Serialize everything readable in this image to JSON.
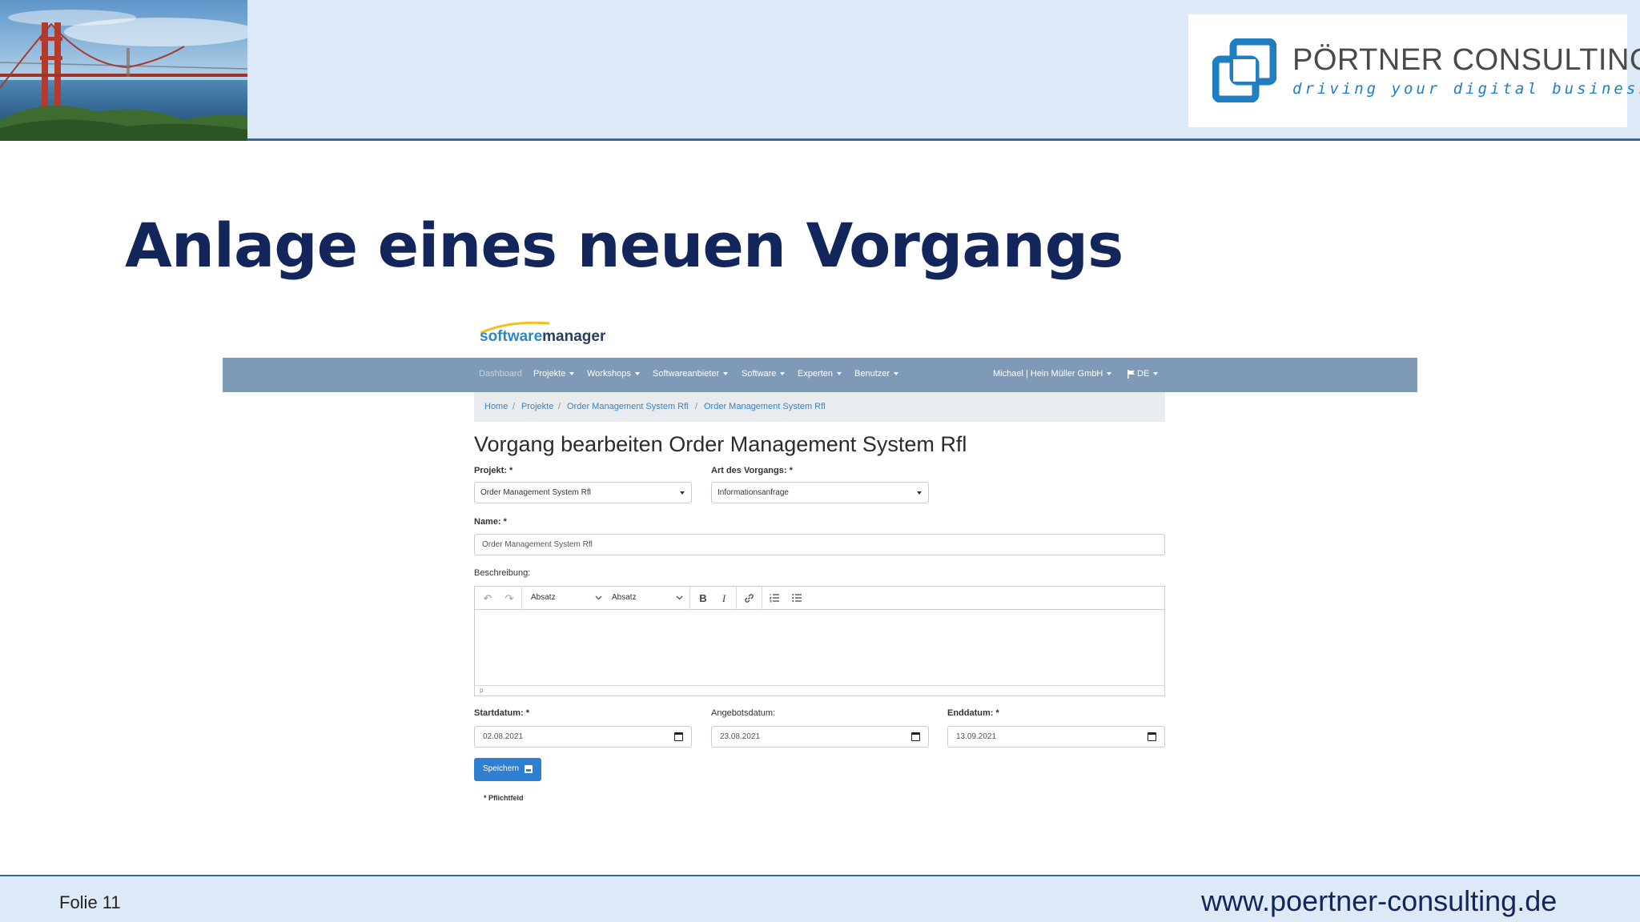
{
  "header": {
    "logo": {
      "name": "PÖRTNER CONSULTING",
      "tagline": "driving your digital business",
      "brand_color": "#1f7fc0"
    }
  },
  "slide": {
    "title": "Anlage eines neuen Vorgangs"
  },
  "app": {
    "brand": {
      "part1": "software",
      "part2": "manager"
    },
    "nav": {
      "items": [
        {
          "label": "Dashboard"
        },
        {
          "label": "Projekte"
        },
        {
          "label": "Workshops"
        },
        {
          "label": "Softwareanbieter"
        },
        {
          "label": "Software"
        },
        {
          "label": "Experten"
        },
        {
          "label": "Benutzer"
        }
      ],
      "user": "Michael | Hein Müller GmbH",
      "language": "DE",
      "bar_color": "#7e9ab6"
    },
    "breadcrumb": [
      "Home",
      "Projekte",
      "Order Management System Rfl",
      "Order Management System Rfl"
    ],
    "form": {
      "heading": "Vorgang bearbeiten Order Management System Rfl",
      "projekt": {
        "label": "Projekt: *",
        "value": "Order Management System Rfl"
      },
      "art": {
        "label": "Art des Vorgangs: *",
        "value": "Informationsanfrage"
      },
      "name": {
        "label": "Name: *",
        "value": "Order Management System Rfl"
      },
      "beschreibung": {
        "label": "Beschreibung:",
        "toolbar": {
          "block_format": "Absatz",
          "font_format": "Absatz",
          "bold": "B",
          "italic": "I"
        },
        "status_path": "p"
      },
      "startdatum": {
        "label": "Startdatum: *",
        "value": "02.08.2021"
      },
      "angebotsdatum": {
        "label": "Angebotsdatum:",
        "value": "23.08.2021"
      },
      "enddatum": {
        "label": "Enddatum: *",
        "value": "13.09.2021"
      },
      "save_label": "Speichern",
      "required_note": "* Pflichtfeld"
    }
  },
  "footer": {
    "slide_number": "Folie 11",
    "url": "www.poertner-consulting.de"
  }
}
